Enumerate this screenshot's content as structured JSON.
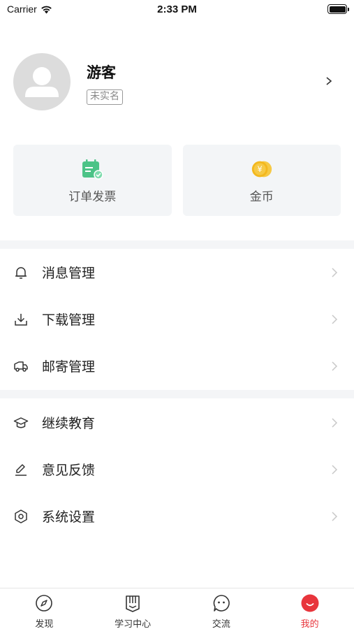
{
  "status_bar": {
    "carrier": "Carrier",
    "time": "2:33 PM"
  },
  "profile": {
    "name": "游客",
    "verify_status": "未实名"
  },
  "quick_cards": [
    {
      "label": "订单发票",
      "icon": "invoice-icon",
      "color": "#4cc387"
    },
    {
      "label": "金币",
      "icon": "gold-coin-icon",
      "color": "#f3b81e"
    }
  ],
  "menu_group_1": [
    {
      "label": "消息管理",
      "icon": "bell-icon"
    },
    {
      "label": "下载管理",
      "icon": "download-icon"
    },
    {
      "label": "邮寄管理",
      "icon": "truck-icon"
    }
  ],
  "menu_group_2": [
    {
      "label": "继续教育",
      "icon": "graduation-cap-icon"
    },
    {
      "label": "意见反馈",
      "icon": "edit-icon"
    },
    {
      "label": "系统设置",
      "icon": "settings-icon"
    }
  ],
  "tabbar": [
    {
      "label": "发现",
      "icon": "compass-icon"
    },
    {
      "label": "学习中心",
      "icon": "book-icon"
    },
    {
      "label": "交流",
      "icon": "chat-icon"
    },
    {
      "label": "我的",
      "icon": "profile-icon",
      "active": true
    }
  ],
  "colors": {
    "accent": "#e8353c",
    "card_bg": "#f3f5f7",
    "divider": "#f4f5f7"
  }
}
